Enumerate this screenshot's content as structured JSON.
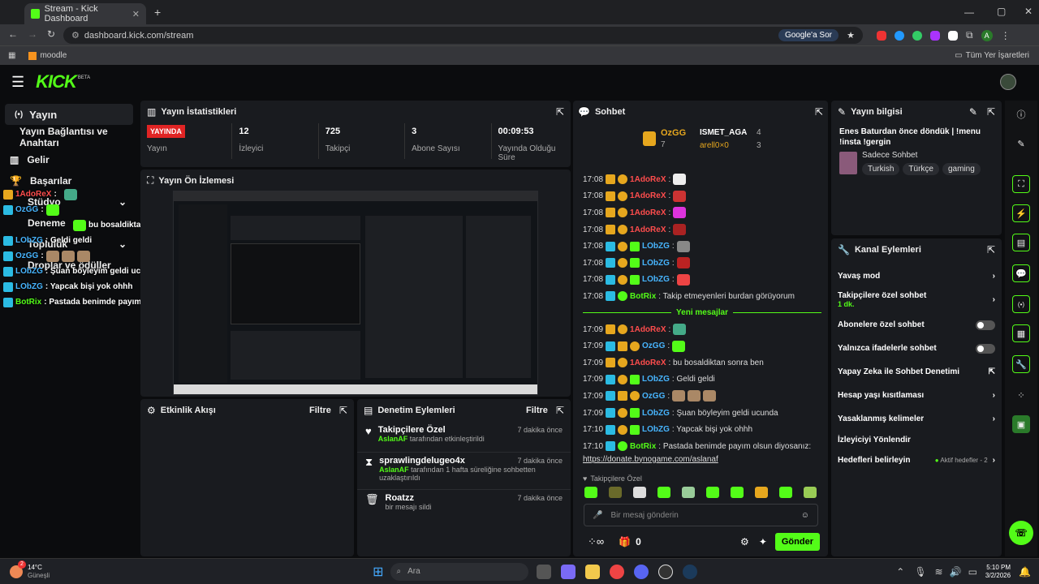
{
  "browser": {
    "tab_title": "Stream - Kick Dashboard",
    "url": "dashboard.kick.com/stream",
    "google_label": "Google'a Sor",
    "bookmark": "moodle",
    "all_bookmarks": "Tüm Yer İşaretleri",
    "profile_initial": "A"
  },
  "brand": {
    "logo": "KICK",
    "beta": "BETA"
  },
  "sidebar": {
    "items": [
      {
        "label": "Yayın",
        "icon": "broadcast-icon"
      },
      {
        "label": "Yayın Bağlantısı ve Anahtarı"
      },
      {
        "label": "Gelir",
        "icon": "chart-icon"
      },
      {
        "label": "Başarılar",
        "icon": "trophy-icon"
      },
      {
        "label": "Stüdyo"
      },
      {
        "label": "Deneme"
      },
      {
        "label": "Topluluk"
      },
      {
        "label": "Droplar ve ödüller"
      }
    ]
  },
  "overlay_chat": [
    {
      "user": "1AdoReX",
      "color": "#ff4d4d",
      "msg": ":"
    },
    {
      "user": "OzGG",
      "color": "#47b5ff",
      "msg": ":"
    },
    {
      "user": "",
      "color": "",
      "msg": "bu bosaldiktan sonra ben"
    },
    {
      "user": "LObZG",
      "color": "#47b5ff",
      "msg": ": Geldi geldi"
    },
    {
      "user": "OzGG",
      "color": "#47b5ff",
      "msg": ":"
    },
    {
      "user": "LObZG",
      "color": "#47b5ff",
      "msg": ": Şuan böyleyim geldi ucunda"
    },
    {
      "user": "LObZG",
      "color": "#47b5ff",
      "msg": ": Yapcak bişi yok   ohhh"
    },
    {
      "user": "BotRix",
      "color": "#53fc18",
      "msg": ": Pastada benimde payım olsun diyosanız: htt"
    }
  ],
  "stats": {
    "title": "Yayın İstatistikleri",
    "status": "YAYINDA",
    "status_label": "Yayın",
    "viewers": "12",
    "viewers_label": "İzleyici",
    "followers": "725",
    "followers_label": "Takipçi",
    "subs": "3",
    "subs_label": "Abone Sayısı",
    "uptime": "00:09:53",
    "uptime_label": "Yayında Olduğu Süre"
  },
  "preview": {
    "title": "Yayın Ön İzlemesi"
  },
  "activity": {
    "title": "Etkinlik Akışı",
    "filter": "Filtre"
  },
  "moderation": {
    "title": "Denetim Eylemleri",
    "filter": "Filtre",
    "items": [
      {
        "title": "Takipçilere Özel",
        "time": "7 dakika önce",
        "user": "AslanAF",
        "desc": "tarafından etkinleştirildi"
      },
      {
        "title": "sprawlingdelugeo4x",
        "time": "7 dakika önce",
        "user": "AslanAF",
        "desc": "tarafından 1 hafta süreliğine sohbetten uzaklaştırıldı"
      },
      {
        "title": "Roatzz",
        "time": "7 dakika önce",
        "user": "",
        "desc": "bir mesajı sildi"
      }
    ]
  },
  "chat": {
    "title": "Sohbet",
    "top1": "OzGG",
    "top1_count": "7",
    "top2": "ISMET_AGA",
    "top2_count": "4",
    "top3": "arell0×0",
    "top3_count": "3",
    "messages": [
      {
        "time": "17:08",
        "user": "1AdoReX",
        "color": "#ff4d4d",
        "text": ":"
      },
      {
        "time": "17:08",
        "user": "1AdoReX",
        "color": "#ff4d4d",
        "text": ":"
      },
      {
        "time": "17:08",
        "user": "1AdoReX",
        "color": "#ff4d4d",
        "text": ":"
      },
      {
        "time": "17:08",
        "user": "1AdoReX",
        "color": "#ff4d4d",
        "text": ":"
      },
      {
        "time": "17:08",
        "user": "LObZG",
        "color": "#47b5ff",
        "text": ":"
      },
      {
        "time": "17:08",
        "user": "LObZG",
        "color": "#47b5ff",
        "text": ":"
      },
      {
        "time": "17:08",
        "user": "LObZG",
        "color": "#47b5ff",
        "text": ":"
      },
      {
        "time": "17:08",
        "user": "BotRix",
        "color": "#53fc18",
        "text": ": Takip etmeyenleri burdan görüyorum"
      }
    ],
    "new_divider": "Yeni mesajlar",
    "new_messages": [
      {
        "time": "17:09",
        "user": "1AdoReX",
        "color": "#ff4d4d",
        "text": ":"
      },
      {
        "time": "17:09",
        "user": "OzGG",
        "color": "#47b5ff",
        "text": ":"
      },
      {
        "time": "17:09",
        "user": "1AdoReX",
        "color": "#ff4d4d",
        "text": ":  bu bosaldiktan sonra ben"
      },
      {
        "time": "17:09",
        "user": "LObZG",
        "color": "#47b5ff",
        "text": ": Geldi geldi"
      },
      {
        "time": "17:09",
        "user": "OzGG",
        "color": "#47b5ff",
        "text": ":"
      },
      {
        "time": "17:09",
        "user": "LObZG",
        "color": "#47b5ff",
        "text": ":  Şuan böyleyim geldi ucunda"
      },
      {
        "time": "17:10",
        "user": "LObZG",
        "color": "#47b5ff",
        "text": ": Yapcak bişi yok  ohhh"
      },
      {
        "time": "17:10",
        "user": "BotRix",
        "color": "#53fc18",
        "text": ": Pastada benimde payım olsun diyosanız:"
      }
    ],
    "link": "https://donate.bynogame.com/aslanaf",
    "mode_label": "Takipçilere Özel",
    "input_placeholder": "Bir mesaj gönderin",
    "points": "0",
    "send": "Gönder"
  },
  "info": {
    "title": "Yayın bilgisi",
    "stream_title": "Enes Baturdan önce döndük | !menu !insta !gergin",
    "category": "Sadece Sohbet",
    "tags": [
      "Turkish",
      "Türkçe",
      "gaming"
    ]
  },
  "channel": {
    "title": "Kanal Eylemleri",
    "items": [
      {
        "label": "Yavaş mod",
        "type": "arrow"
      },
      {
        "label": "Takipçilere özel sohbet",
        "sub": "1 dk.",
        "type": "arrow"
      },
      {
        "label": "Abonelere özel sohbet",
        "type": "toggle"
      },
      {
        "label": "Yalnızca ifadelerle sohbet",
        "type": "toggle"
      },
      {
        "label": "Yapay Zeka ile Sohbet Denetimi",
        "type": "ext"
      },
      {
        "label": "Hesap yaşı kısıtlaması",
        "type": "arrow"
      },
      {
        "label": "Yasaklanmış kelimeler",
        "type": "arrow"
      },
      {
        "label": "İzleyiciyi Yönlendir",
        "type": "none"
      },
      {
        "label": "Hedefleri belirleyin",
        "status": "Aktif hedefler - 2",
        "type": "arrow"
      }
    ]
  },
  "taskbar": {
    "weather": "14°C",
    "weather_desc": "Güneşli",
    "search": "Ara",
    "time": "5:10 PM",
    "date": "3/2/2026",
    "badge": "2"
  },
  "colors": {
    "accent": "#53fc18",
    "panel": "#191b1f",
    "live": "#e02424"
  }
}
